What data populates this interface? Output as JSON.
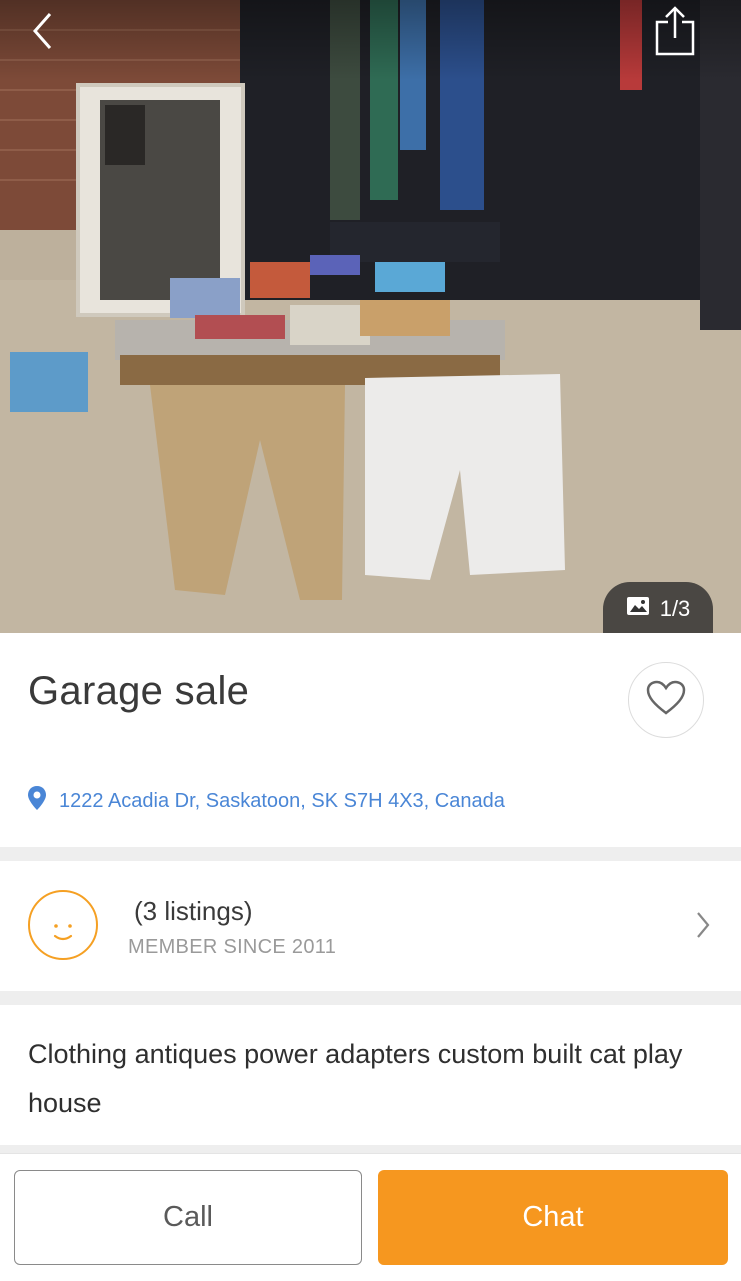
{
  "listing": {
    "photo_counter": "1/3",
    "title": "Garage sale",
    "location": "1222 Acadia Dr, Saskatoon, SK S7H 4X3, Canada",
    "description": "Clothing antiques power adapters custom built cat play house"
  },
  "seller": {
    "listings": "(3 listings)",
    "member_since": "MEMBER SINCE 2011"
  },
  "actions": {
    "call_label": "Call",
    "chat_label": "Chat"
  },
  "icons": {
    "back": "chevron-left-icon",
    "share": "share-icon",
    "gallery": "image-icon",
    "favorite": "heart-icon",
    "location": "map-pin-icon",
    "avatar": "smiley-face-icon",
    "more": "chevron-right-icon"
  },
  "colors": {
    "accent": "#f6971f",
    "link": "#4a86d6",
    "avatar_border": "#f5a023"
  }
}
